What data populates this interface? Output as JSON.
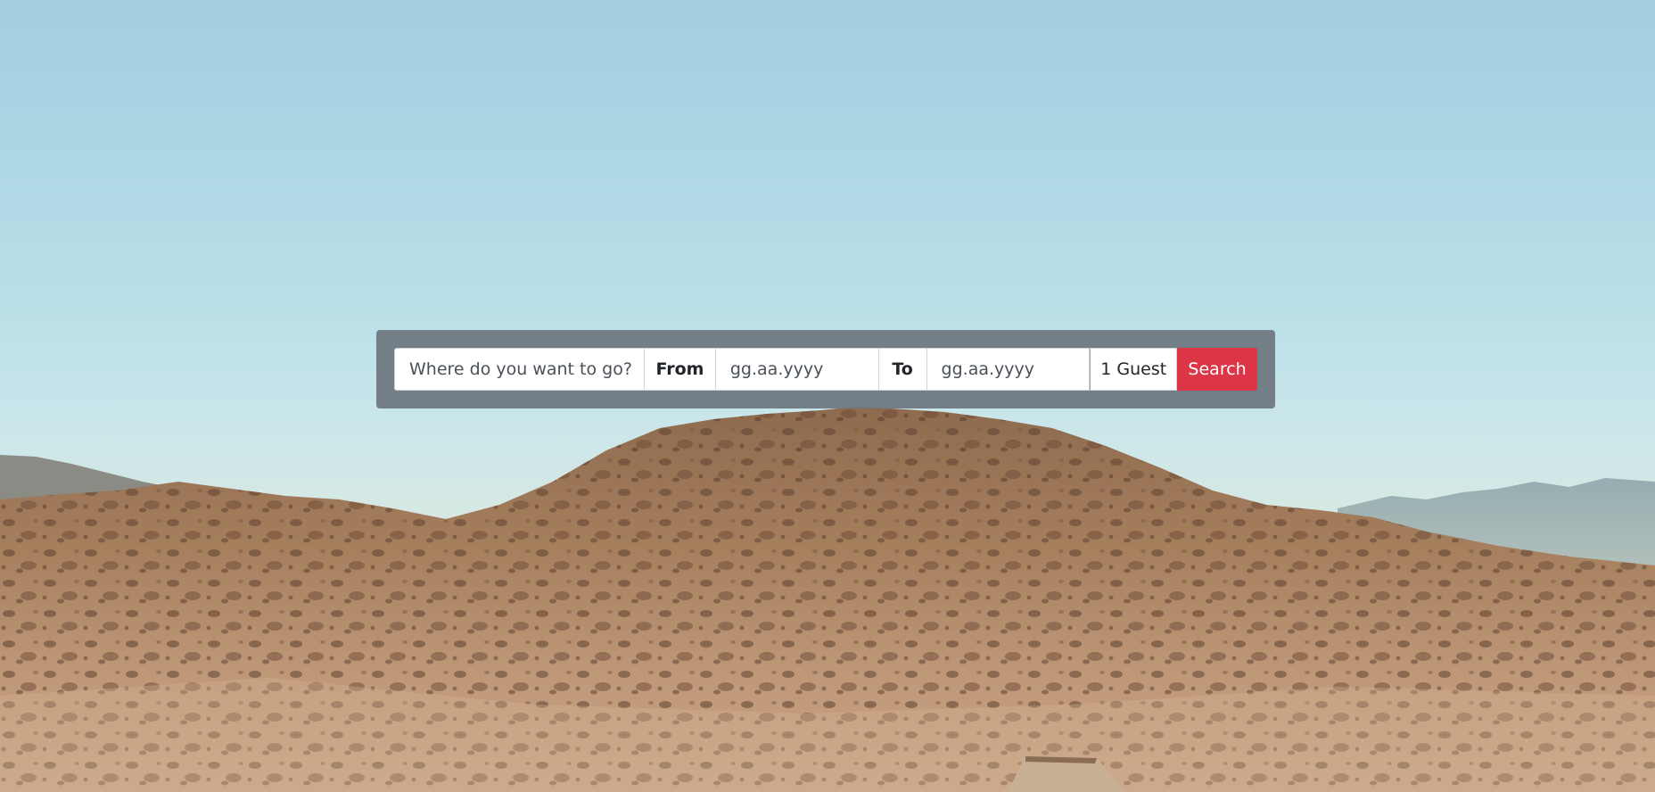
{
  "search": {
    "destination_placeholder": "Where do you want to go?",
    "from_label": "From",
    "from_placeholder": "gg.aa.yyyy",
    "to_label": "To",
    "to_placeholder": "gg.aa.yyyy",
    "guests_label": "1 Guest",
    "search_label": "Search"
  },
  "colors": {
    "sky": "#aed7e5",
    "panel": "#6c757d",
    "search_button": "#dc3545",
    "hills": "#a87c5a"
  }
}
